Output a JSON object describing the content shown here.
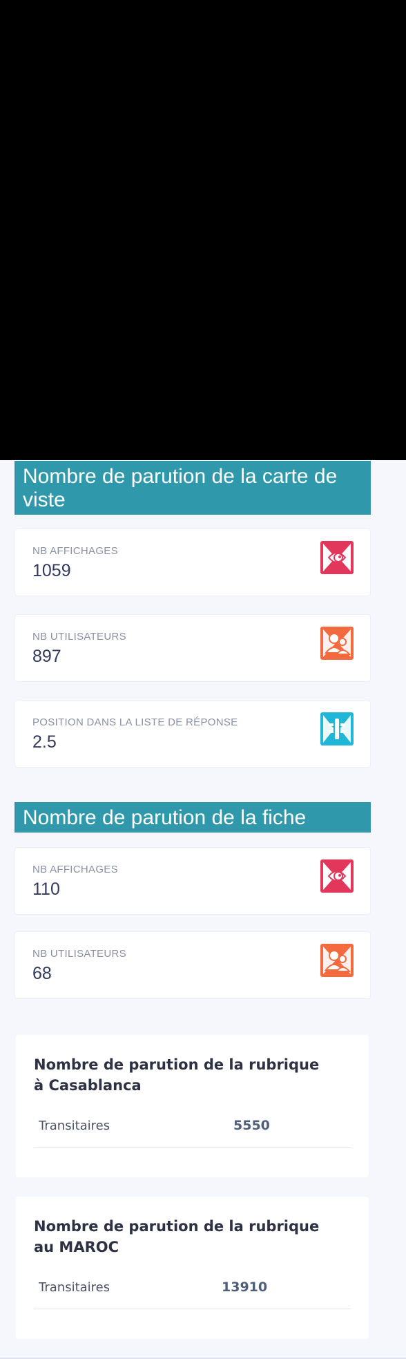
{
  "carte": {
    "title": "Nombre de parution de la carte de viste",
    "cards": [
      {
        "label": "NB AFFICHAGES",
        "value": "1059",
        "icon": "eye-icon"
      },
      {
        "label": "NB UTILISATEURS",
        "value": "897",
        "icon": "users-icon"
      },
      {
        "label": "POSITION DANS LA LISTE DE RÉPONSE",
        "value": "2.5",
        "icon": "list-position-icon"
      }
    ]
  },
  "fiche": {
    "title": "Nombre de parution de la fiche",
    "cards": [
      {
        "label": "NB AFFICHAGES",
        "value": "110",
        "icon": "eye-icon"
      },
      {
        "label": "NB UTILISATEURS",
        "value": "68",
        "icon": "users-icon"
      }
    ]
  },
  "rubrique_casablanca": {
    "title": "Nombre de parution de la rubrique à Casablanca",
    "rows": [
      {
        "label": "Transitaires",
        "value": "5550"
      }
    ]
  },
  "rubrique_maroc": {
    "title": "Nombre de parution de la rubrique au MAROC",
    "rows": [
      {
        "label": "Transitaires",
        "value": "13910"
      }
    ]
  },
  "colors": {
    "header_teal": "#2f99ab",
    "eye_icon": "#e2365b",
    "users_icon": "#f26a3d",
    "list_icon": "#1fb6d8"
  }
}
